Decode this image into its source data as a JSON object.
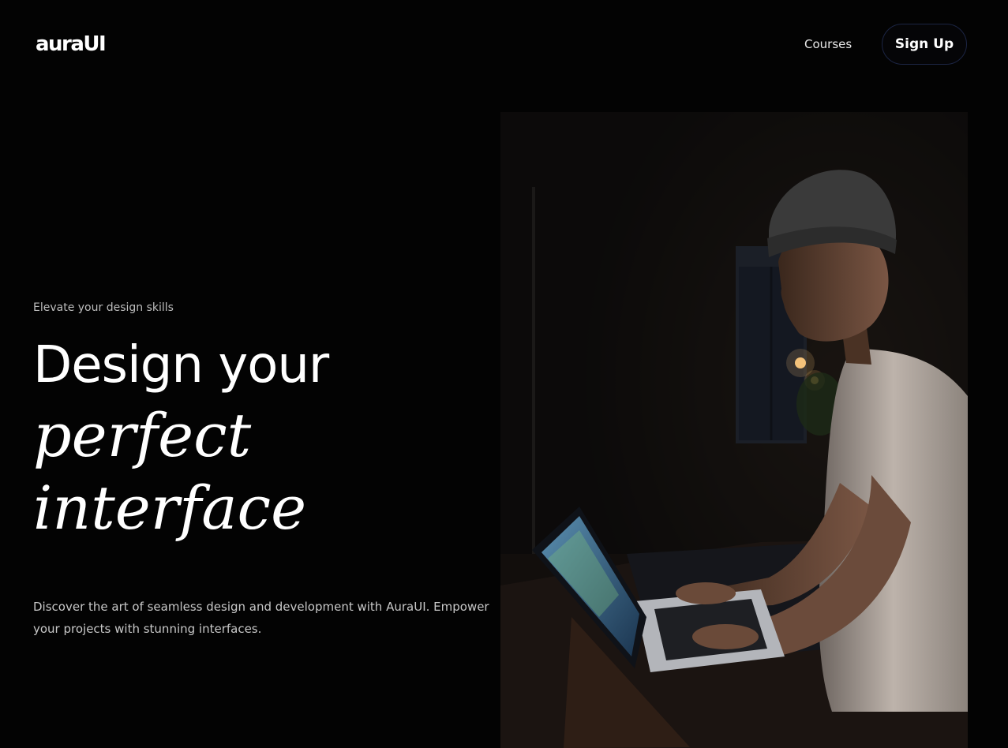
{
  "header": {
    "logo": "auraUI",
    "nav": {
      "courses_label": "Courses"
    },
    "signup_label": "Sign Up"
  },
  "hero": {
    "eyebrow": "Elevate your design skills",
    "headline": {
      "line1": "Design your",
      "line2": "perfect",
      "line3": "interface"
    },
    "description": "Discover the art of seamless design and development with AuraUI. Empower your projects with stunning interfaces.",
    "image": {
      "subject": "person-using-laptop"
    }
  },
  "colors": {
    "background": "#030303",
    "text_primary": "#ffffff",
    "text_muted": "#bdbdbd",
    "button_border": "#1c2544"
  }
}
